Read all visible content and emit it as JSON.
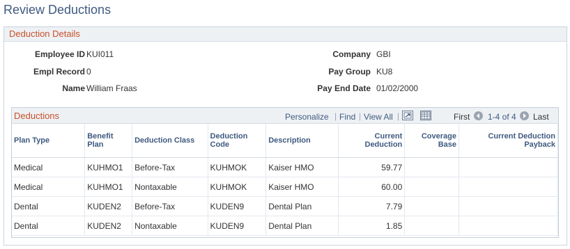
{
  "page_title": "Review Deductions",
  "details": {
    "title": "Deduction Details",
    "fields": [
      {
        "label": "Employee ID",
        "value": "KUI011"
      },
      {
        "label": "Empl Record",
        "value": "0"
      },
      {
        "label": "Name",
        "value": "William Fraas"
      },
      {
        "label": "Company",
        "value": "GBI"
      },
      {
        "label": "Pay Group",
        "value": "KU8"
      },
      {
        "label": "Pay End Date",
        "value": "01/02/2000"
      }
    ]
  },
  "grid": {
    "title": "Deductions",
    "personalize": "Personalize",
    "find": "Find",
    "view_all": "View All",
    "first": "First",
    "range": "1-4 of 4",
    "last": "Last",
    "columns": [
      {
        "label": "Plan Type"
      },
      {
        "label": "Benefit Plan"
      },
      {
        "label": "Deduction Class"
      },
      {
        "label": "Deduction Code"
      },
      {
        "label": "Description"
      },
      {
        "label": "Current Deduction"
      },
      {
        "label": "Coverage Base"
      },
      {
        "label": "Current Deduction Payback"
      }
    ],
    "rows": [
      {
        "plan_type": "Medical",
        "benefit_plan": "KUHMO1",
        "deduction_class": "Before-Tax",
        "deduction_code": "KUHMOK",
        "description": "Kaiser HMO",
        "current_deduction": "59.77",
        "coverage_base": "",
        "payback": ""
      },
      {
        "plan_type": "Medical",
        "benefit_plan": "KUHMO1",
        "deduction_class": "Nontaxable",
        "deduction_code": "KUHMOK",
        "description": "Kaiser HMO",
        "current_deduction": "60.00",
        "coverage_base": "",
        "payback": ""
      },
      {
        "plan_type": "Dental",
        "benefit_plan": "KUDEN2",
        "deduction_class": "Before-Tax",
        "deduction_code": "KUDEN9",
        "description": "Dental Plan",
        "current_deduction": "7.79",
        "coverage_base": "",
        "payback": ""
      },
      {
        "plan_type": "Dental",
        "benefit_plan": "KUDEN2",
        "deduction_class": "Nontaxable",
        "deduction_code": "KUDEN9",
        "description": "Dental Plan",
        "current_deduction": "1.85",
        "coverage_base": "",
        "payback": ""
      }
    ]
  },
  "icons": {
    "zoom": "grid-zoom-icon",
    "download": "download-to-spreadsheet-icon",
    "prev": "previous-page-icon",
    "next": "next-page-icon"
  }
}
